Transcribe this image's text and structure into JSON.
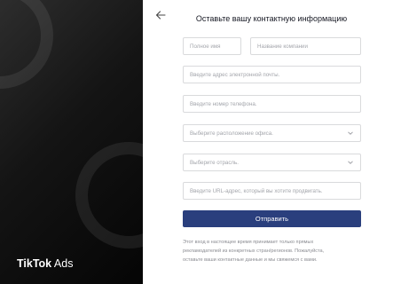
{
  "brand": {
    "part1": "TikTok",
    "part2": " Ads"
  },
  "form": {
    "title": "Оставьте вашу контактную информацию",
    "first_name_placeholder": "Полное имя",
    "company_placeholder": "Название компании",
    "email_placeholder": "Введите адрес электронной почты.",
    "phone_placeholder": "Введите номер телефона.",
    "office_placeholder": "Выберите расположение офиса.",
    "industry_placeholder": "Выберите отрасль.",
    "url_placeholder": "Введите URL-адрес, который вы хотите продвигать.",
    "submit_label": "Отправить",
    "note_lines": [
      "Этот вход в настоящее время принимает только прямых",
      "рекламодателей из конкретных стран/регионов. Пожалуйста,",
      "оставьте ваши контактные данные и мы свяжемся с вами."
    ]
  },
  "icons": {
    "back": "arrow-left-icon",
    "dropdown": "chevron-down-icon"
  },
  "colors": {
    "panel": "#141414",
    "button": "#2a3f7d",
    "text": "#161823",
    "placeholder": "#a3a5ab"
  }
}
